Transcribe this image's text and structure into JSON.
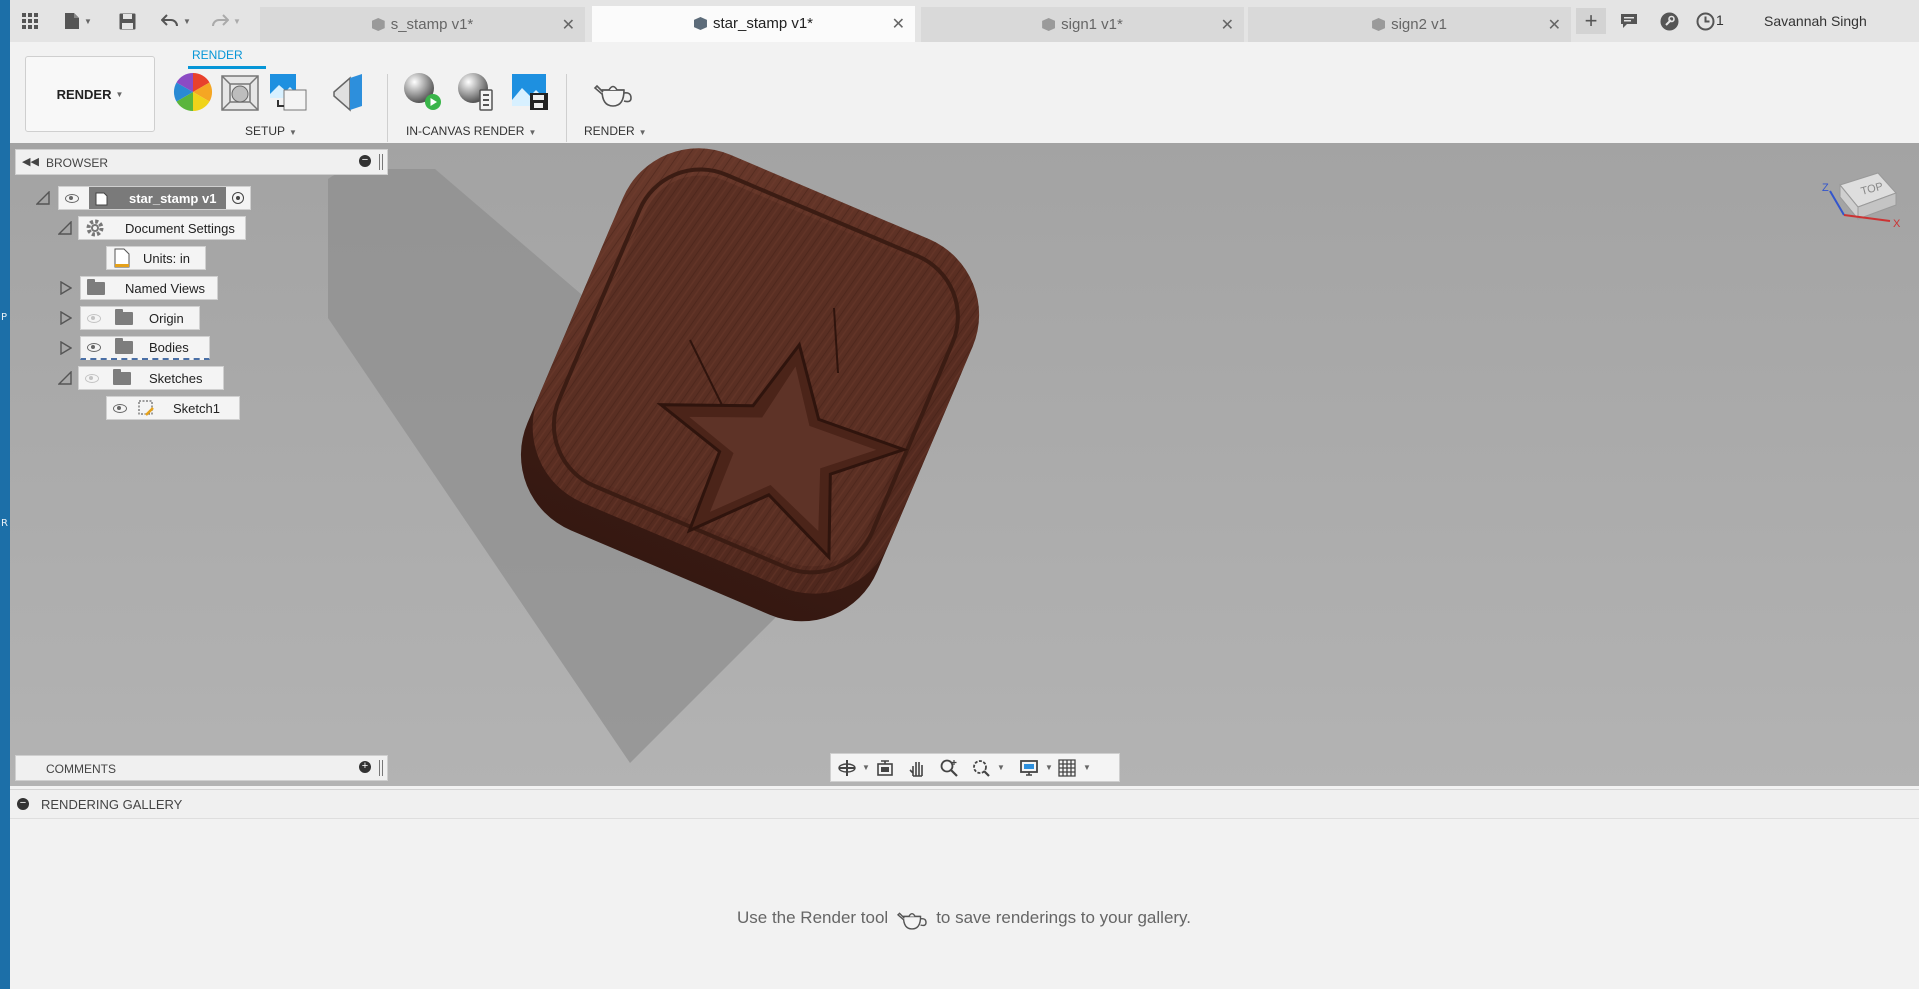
{
  "tabs": [
    {
      "label": "s_stamp v1*",
      "active": false
    },
    {
      "label": "star_stamp v1*",
      "active": true
    },
    {
      "label": "sign1 v1*",
      "active": false
    },
    {
      "label": "sign2 v1",
      "active": false
    }
  ],
  "topbar": {
    "notification_count": "1",
    "user_name": "Savannah Singh"
  },
  "ribbon": {
    "workspace": "RENDER",
    "tab": "RENDER",
    "groups": {
      "setup": "SETUP",
      "in_canvas": "IN-CANVAS RENDER",
      "render": "RENDER"
    }
  },
  "browser": {
    "title": "BROWSER",
    "root": "star_stamp v1",
    "nodes": {
      "document_settings": "Document Settings",
      "units": "Units: in",
      "named_views": "Named Views",
      "origin": "Origin",
      "bodies": "Bodies",
      "sketches": "Sketches",
      "sketch1": "Sketch1"
    }
  },
  "viewcube": {
    "face": "TOP",
    "axis_z": "Z",
    "axis_x": "X"
  },
  "comments": {
    "title": "COMMENTS"
  },
  "gallery": {
    "title": "RENDERING GALLERY",
    "msg_before": "Use the Render tool",
    "msg_after": "to save renderings to your gallery."
  },
  "icons": [
    "apps-grid-icon",
    "file-icon",
    "save-icon",
    "undo-icon",
    "redo-icon",
    "new-tab-icon",
    "comments-icon",
    "help-icon",
    "clock-icon",
    "appearance-icon",
    "scene-settings-icon",
    "environment-library-icon",
    "decal-icon",
    "in-canvas-render-icon",
    "in-canvas-settings-icon",
    "capture-image-icon",
    "render-teapot-icon",
    "orbit-icon",
    "look-at-icon",
    "pan-icon",
    "zoom-icon",
    "fit-icon",
    "display-settings-icon",
    "grid-icon"
  ]
}
